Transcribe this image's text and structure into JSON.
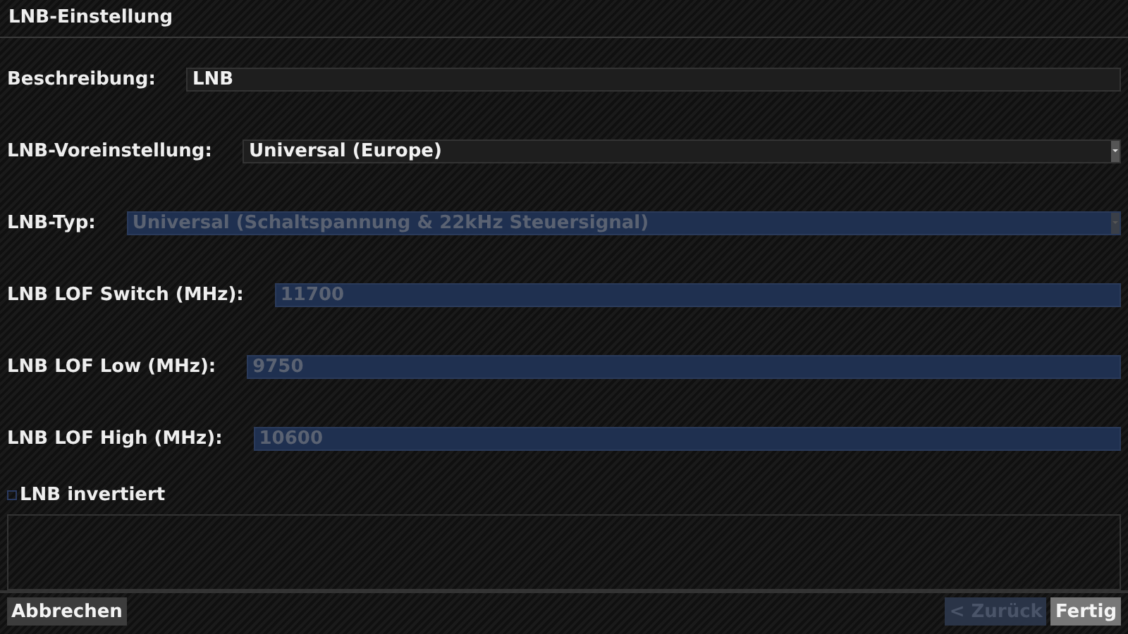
{
  "window": {
    "title": "LNB-Einstellung"
  },
  "fields": [
    {
      "label": "Beschreibung:",
      "kind": "text",
      "value": "LNB",
      "disabled": false
    },
    {
      "label": "LNB-Voreinstellung:",
      "kind": "dropdown",
      "value": "Universal (Europe)",
      "disabled": false
    },
    {
      "label": "LNB-Typ:",
      "kind": "dropdown",
      "value": "Universal (Schaltspannung & 22kHz Steuersignal)",
      "disabled": true
    },
    {
      "label": "LNB LOF Switch (MHz):",
      "kind": "text",
      "value": "11700",
      "disabled": true
    },
    {
      "label": "LNB LOF Low (MHz):",
      "kind": "text",
      "value": "9750",
      "disabled": true
    },
    {
      "label": "LNB LOF High (MHz):",
      "kind": "text",
      "value": "10600",
      "disabled": true
    }
  ],
  "checkbox": {
    "label": "LNB invertiert",
    "checked": false
  },
  "buttons_left": [
    {
      "label": "Abbrechen",
      "disabled": false
    }
  ],
  "buttons_right": [
    {
      "label": "< Zurück",
      "disabled": true
    },
    {
      "label": "Fertig",
      "disabled": false
    }
  ]
}
